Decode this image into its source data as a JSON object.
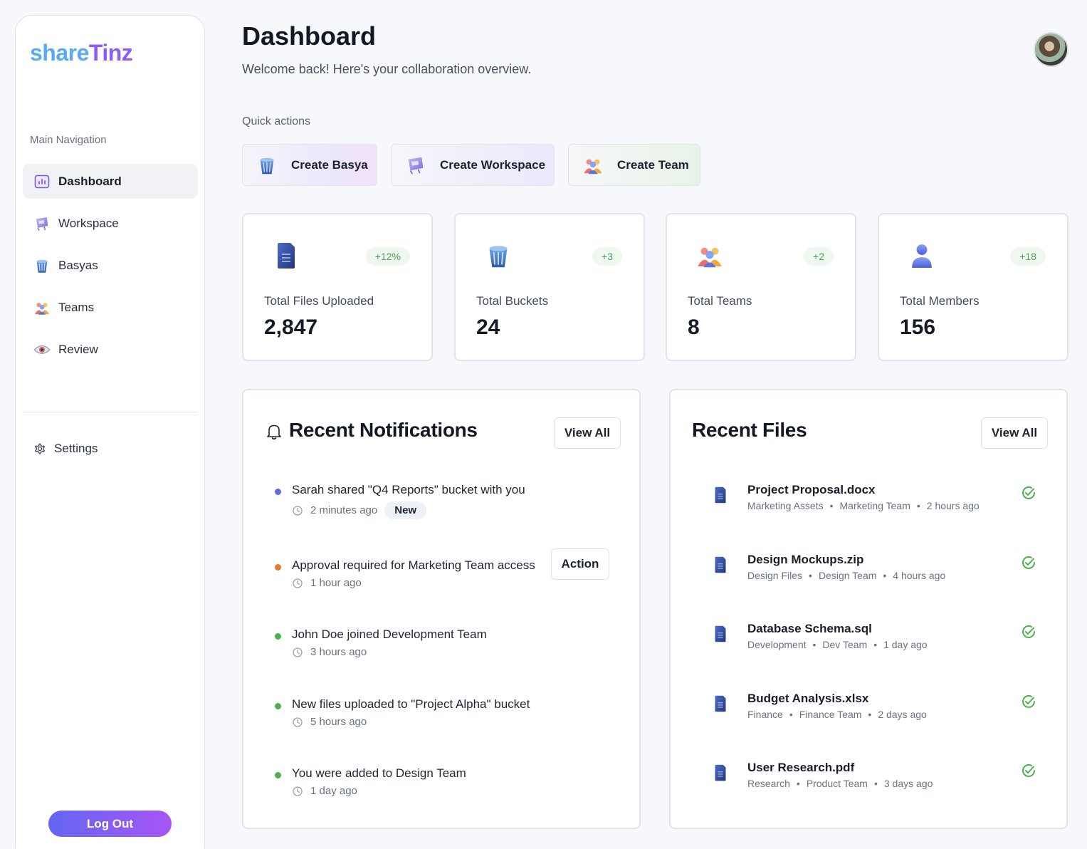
{
  "brand": {
    "part1": "share",
    "part2": "Tinz"
  },
  "sidebar": {
    "nav_title": "Main Navigation",
    "items": [
      {
        "label": "Dashboard",
        "icon": "chart-icon",
        "active": true
      },
      {
        "label": "Workspace",
        "icon": "workspace-icon"
      },
      {
        "label": "Basyas",
        "icon": "bucket-icon"
      },
      {
        "label": "Teams",
        "icon": "team-icon"
      },
      {
        "label": "Review",
        "icon": "eye-icon"
      }
    ],
    "settings_label": "Settings",
    "logout_label": "Log Out"
  },
  "header": {
    "title": "Dashboard",
    "subtitle": "Welcome back! Here's your collaboration overview."
  },
  "quick_actions": {
    "title": "Quick actions",
    "buttons": [
      {
        "label": "Create Basya",
        "icon": "bucket-icon"
      },
      {
        "label": "Create Workspace",
        "icon": "workspace-icon"
      },
      {
        "label": "Create Team",
        "icon": "team-icon"
      }
    ]
  },
  "stats": [
    {
      "label": "Total Files Uploaded",
      "value": "2,847",
      "badge": "+12%",
      "icon": "file-icon"
    },
    {
      "label": "Total Buckets",
      "value": "24",
      "badge": "+3",
      "icon": "bucket-icon"
    },
    {
      "label": "Total Teams",
      "value": "8",
      "badge": "+2",
      "icon": "team-icon"
    },
    {
      "label": "Total Members",
      "value": "156",
      "badge": "+18",
      "icon": "user-icon"
    }
  ],
  "notifications": {
    "title": "Recent Notifications",
    "view_all": "View All",
    "items": [
      {
        "message": "Sarah shared \"Q4 Reports\" bucket with you",
        "time": "2 minutes ago",
        "badge": "New",
        "color": "#5b6be0"
      },
      {
        "message": "Approval required for Marketing Team access",
        "time": "1 hour ago",
        "action": "Action",
        "color": "#e07a2e"
      },
      {
        "message": "John Doe joined Development Team",
        "time": "3 hours ago",
        "color": "#4caf50"
      },
      {
        "message": "New files uploaded to \"Project Alpha\" bucket",
        "time": "5 hours ago",
        "color": "#4caf50"
      },
      {
        "message": "You were added to Design Team",
        "time": "1 day ago",
        "color": "#4caf50"
      }
    ]
  },
  "recent_files": {
    "title": "Recent Files",
    "view_all": "View All",
    "items": [
      {
        "name": "Project Proposal.docx",
        "folder": "Marketing Assets",
        "team": "Marketing Team",
        "time": "2 hours ago"
      },
      {
        "name": "Design Mockups.zip",
        "folder": "Design Files",
        "team": "Design Team",
        "time": "4 hours ago"
      },
      {
        "name": "Database Schema.sql",
        "folder": "Development",
        "team": "Dev Team",
        "time": "1 day ago"
      },
      {
        "name": "Budget Analysis.xlsx",
        "folder": "Finance",
        "team": "Finance Team",
        "time": "2 days ago"
      },
      {
        "name": "User Research.pdf",
        "folder": "Research",
        "team": "Product Team",
        "time": "3 days ago"
      }
    ]
  },
  "colors": {
    "accent": "#8b5cf6",
    "brand_blue": "#5aa9f5",
    "success": "#4caf50"
  }
}
